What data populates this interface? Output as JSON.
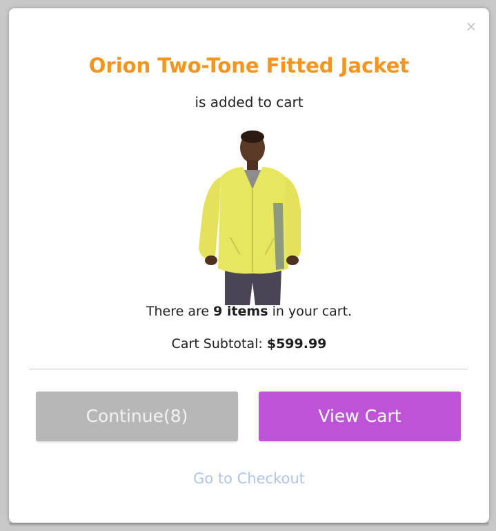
{
  "modal": {
    "close_label": "×",
    "product_title": "Orion Two-Tone Fitted Jacket",
    "added_text": "is added to cart",
    "cart_count_prefix": "There are ",
    "cart_count_value": "9 items",
    "cart_count_suffix": " in your cart.",
    "subtotal_label": "Cart Subtotal: ",
    "subtotal_value": "$599.99",
    "continue_label": "Continue(8)",
    "view_cart_label": "View Cart",
    "checkout_label": "Go to Checkout"
  },
  "colors": {
    "title": "#f7941e",
    "view_cart_button": "#bd54d7",
    "continue_button": "#b7b7b7",
    "checkout_link": "#aec6e6"
  },
  "icons": {
    "close": "close-icon",
    "product": "jacket-product-image"
  }
}
